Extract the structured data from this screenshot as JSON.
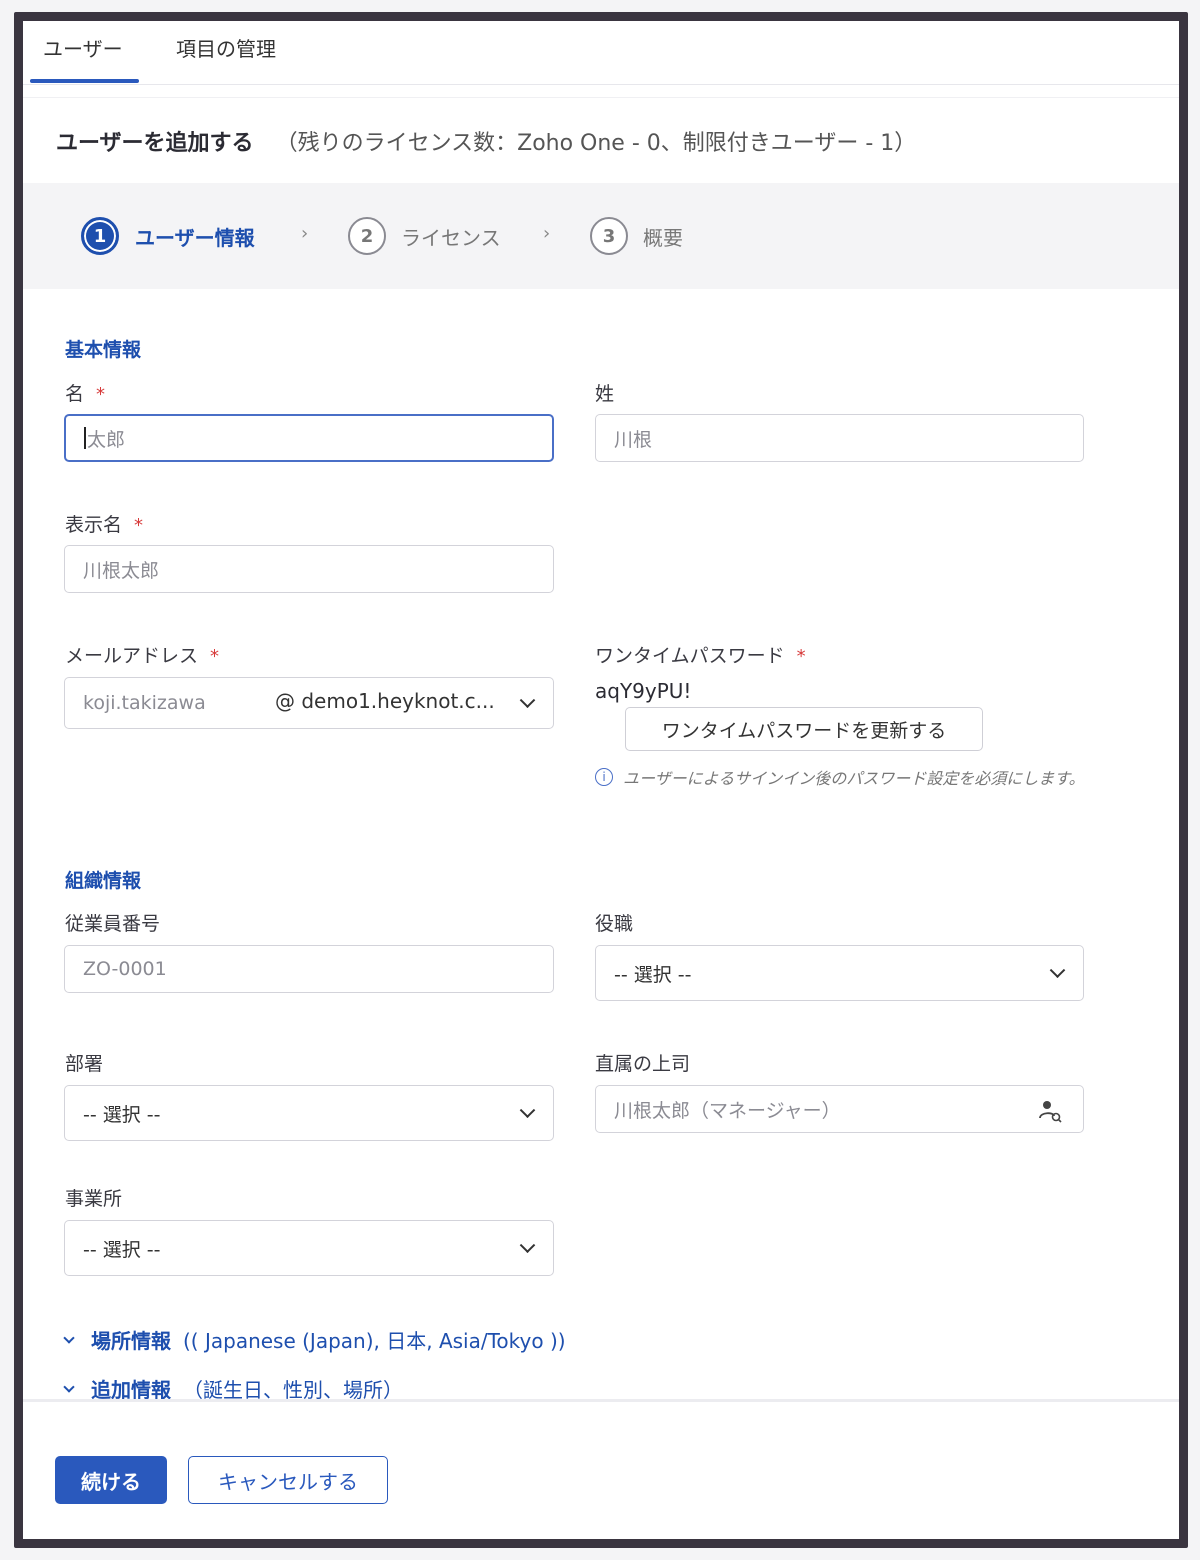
{
  "tabs": {
    "users": "ユーザー",
    "manage_fields": "項目の管理"
  },
  "title": {
    "main": "ユーザーを追加する",
    "sub": "（残りのライセンス数：Zoho One - 0、制限付きユーザー - 1）"
  },
  "steps": [
    {
      "num": "1",
      "label": "ユーザー情報",
      "active": true
    },
    {
      "num": "2",
      "label": "ライセンス",
      "active": false
    },
    {
      "num": "3",
      "label": "概要",
      "active": false
    }
  ],
  "step_separator": "›",
  "basic_info": {
    "section_title": "基本情報",
    "first_name_label": "名",
    "first_name_value": "太郎",
    "last_name_label": "姓",
    "last_name_placeholder": "川根",
    "display_name_label": "表示名",
    "display_name_placeholder": "川根太郎",
    "email_label": "メールアドレス",
    "email_placeholder": "koji.takizawa",
    "email_domain": "@  demo1.heyknot.c...",
    "otp_label": "ワンタイムパスワード",
    "otp_value": "aqY9yPU!",
    "otp_refresh_button": "ワンタイムパスワードを更新する",
    "otp_hint": "ユーザーによるサインイン後のパスワード設定を必須にします。",
    "required_mark": "*"
  },
  "org_info": {
    "section_title": "組織情報",
    "employee_id_label": "従業員番号",
    "employee_id_placeholder": "ZO-0001",
    "role_label": "役職",
    "role_value": "-- 選択 --",
    "department_label": "部署",
    "department_value": "-- 選択 --",
    "manager_label": "直属の上司",
    "manager_placeholder": "川根太郎（マネージャー）",
    "office_label": "事業所",
    "office_value": "-- 選択 --"
  },
  "expanders": [
    {
      "title": "場所情報",
      "sub": "(( Japanese (Japan), 日本, Asia/Tokyo ))"
    },
    {
      "title": "追加情報",
      "sub": "（誕生日、性別、場所）"
    }
  ],
  "footer": {
    "continue": "続ける",
    "cancel": "キャンセルする"
  },
  "colors": {
    "accent": "#2a59bd",
    "required": "#d73a3a",
    "frame": "#3a3540"
  },
  "icons": [
    "info-icon",
    "chevron-down-icon",
    "user-search-icon",
    "chevron-right-icon"
  ]
}
